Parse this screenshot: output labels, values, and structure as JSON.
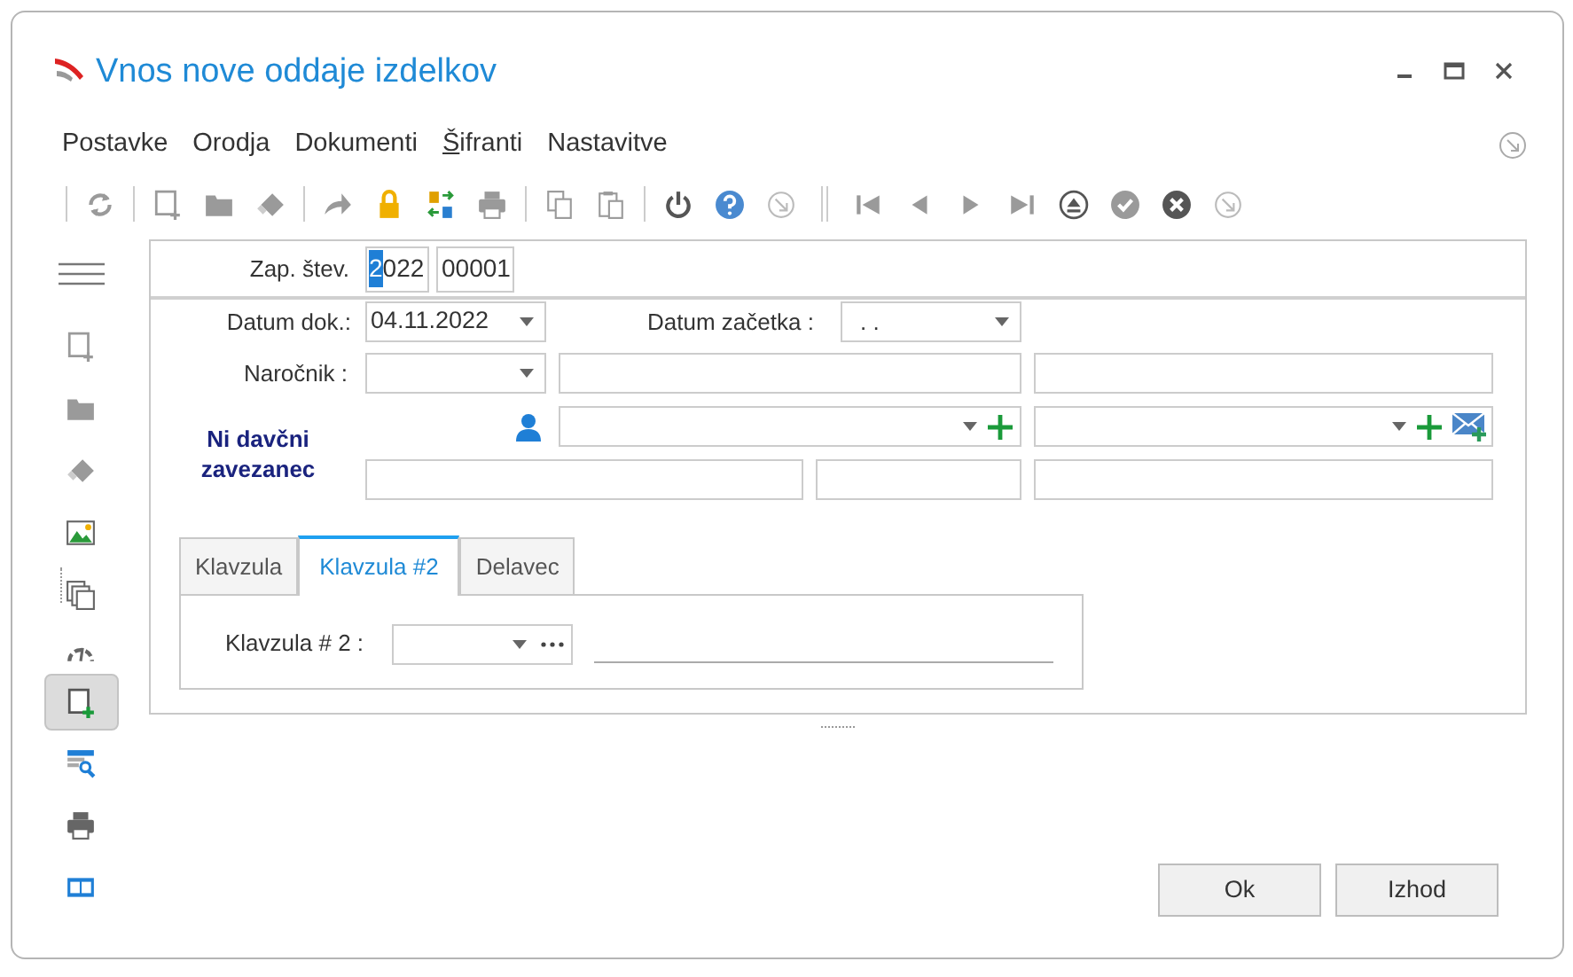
{
  "window": {
    "title": "Vnos nove oddaje izdelkov"
  },
  "menu": [
    {
      "label": "Postavke",
      "mnemonic_underlined": false
    },
    {
      "label": "Orodja",
      "mnemonic_underlined": false
    },
    {
      "label": "Dokumenti",
      "mnemonic_underlined": false
    },
    {
      "label": "Šifranti",
      "mnemonic_underlined": true
    },
    {
      "label": "Nastavitve",
      "mnemonic_underlined": false
    }
  ],
  "sidebar_tools": [
    {
      "kind": "new-doc",
      "selected": false
    },
    {
      "kind": "folder",
      "selected": false
    },
    {
      "kind": "eraser",
      "selected": false
    },
    {
      "kind": "image",
      "selected": false
    },
    {
      "kind": "copy",
      "selected": false
    },
    {
      "kind": "gauge",
      "selected": false
    },
    {
      "kind": "new-doc-plus",
      "selected": true
    },
    {
      "kind": "table-search",
      "selected": false
    },
    {
      "kind": "printer",
      "selected": false
    },
    {
      "kind": "view",
      "selected": false
    }
  ],
  "record_number": {
    "label": "Zap. štev.",
    "year": "2022",
    "first_char_selected": true,
    "number": "00001"
  },
  "document_date": {
    "label": "Datum dok.:",
    "value": "04.11.2022"
  },
  "start_date": {
    "label": "Datum začetka :",
    "value": ". ."
  },
  "customer": {
    "label": "Naročnik :"
  },
  "tax_status": "Ni davčni zavezanec",
  "tabs": [
    {
      "label": "Klavzula",
      "selected": false
    },
    {
      "label": "Klavzula #2",
      "selected": true
    },
    {
      "label": "Delavec",
      "selected": false
    }
  ],
  "clause": {
    "label": "Klavzula # 2 :"
  },
  "buttons": [
    {
      "label": "Ok"
    },
    {
      "label": "Izhod"
    }
  ]
}
